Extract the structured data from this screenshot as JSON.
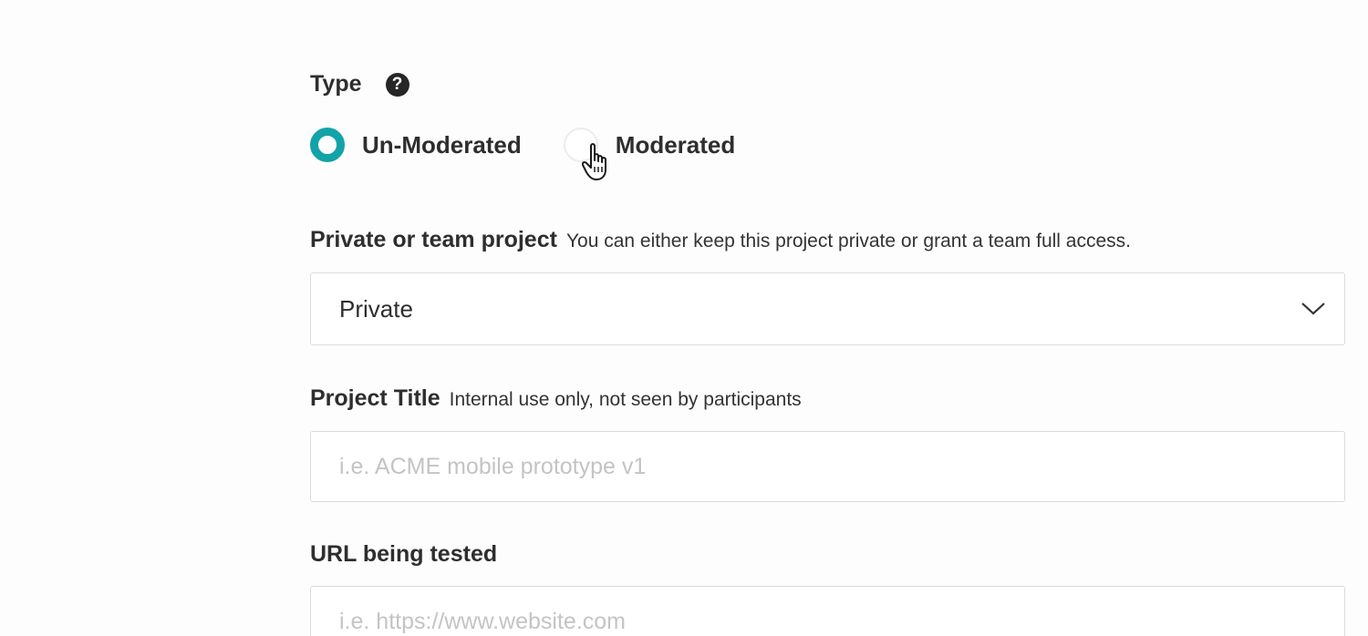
{
  "type_section": {
    "label": "Type",
    "help_icon": "question-circle-icon",
    "options": [
      {
        "label": "Un-Moderated",
        "selected": true
      },
      {
        "label": "Moderated",
        "selected": false
      }
    ],
    "accent_color": "#12a3a8"
  },
  "privacy": {
    "label": "Private or team project",
    "hint": "You can either keep this project private or grant a team full access.",
    "selected_value": "Private",
    "icon": "chevron-down-icon"
  },
  "project_title": {
    "label": "Project Title",
    "hint": "Internal use only, not seen by participants",
    "value": "",
    "placeholder": "i.e. ACME mobile prototype v1"
  },
  "url_tested": {
    "label": "URL being tested",
    "value": "",
    "placeholder": "i.e. https://www.website.com"
  }
}
